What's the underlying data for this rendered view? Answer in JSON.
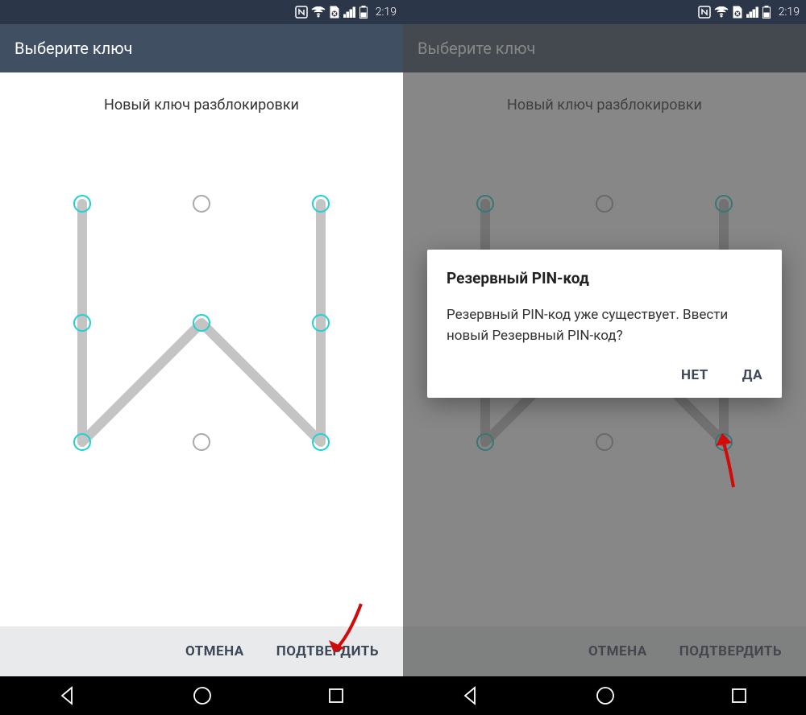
{
  "status": {
    "time": "2:19"
  },
  "header": {
    "title": "Выберите ключ"
  },
  "content": {
    "subtitle": "Новый ключ разблокировки"
  },
  "pattern": {
    "active_dots": [
      0,
      2,
      3,
      4,
      5,
      6,
      8
    ],
    "path_points": [
      [
        0,
        0
      ],
      [
        0,
        2
      ],
      [
        1,
        1
      ],
      [
        2,
        2
      ],
      [
        2,
        0
      ]
    ]
  },
  "buttons": {
    "cancel": "ОТМЕНА",
    "confirm": "ПОДТВЕРДИТЬ"
  },
  "dialog": {
    "title": "Резервный PIN-код",
    "body": "Резервный PIN-код уже существует. Ввести новый Резервный PIN-код?",
    "no": "НЕТ",
    "yes": "ДА"
  }
}
